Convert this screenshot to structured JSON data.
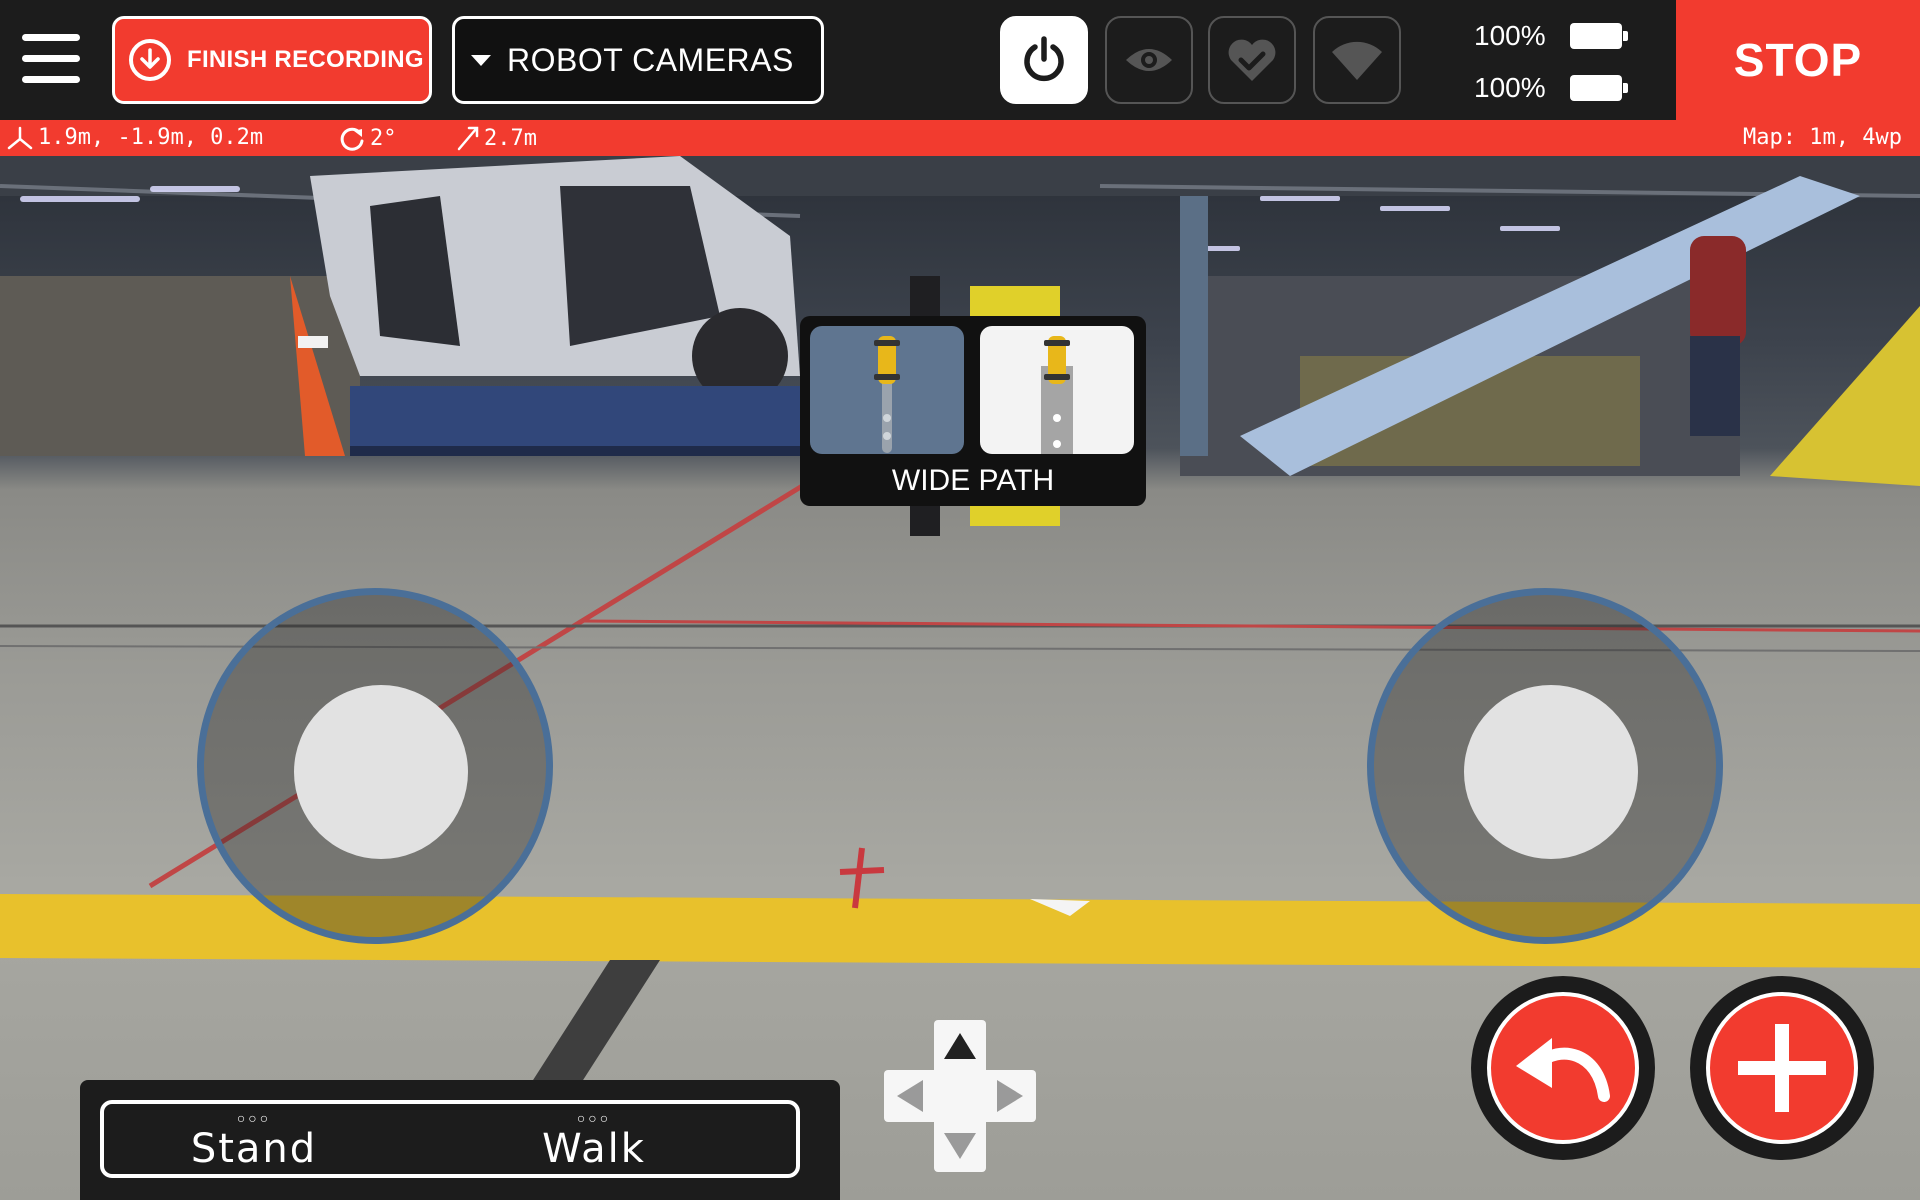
{
  "topbar": {
    "finish_recording_label": "FINISH RECORDING",
    "camera_select_label": "ROBOT CAMERAS",
    "battery_1": "100%",
    "battery_2": "100%",
    "stop_label": "STOP"
  },
  "status": {
    "position": "1.9m, -1.9m, 0.2m",
    "rotation": "2°",
    "distance": "2.7m",
    "map": "Map: 1m, 4wp"
  },
  "path_mode": {
    "label": "WIDE PATH"
  },
  "controls": {
    "stand_label": "Stand",
    "walk_label": "Walk",
    "mode_dots": "○○○"
  },
  "colors": {
    "accent_red": "#f23b2f",
    "bar_dark": "#1c1c1c",
    "joystick_ring": "#4a6f98",
    "floor_yellow": "#e8c12c"
  },
  "icons": {
    "menu": "hamburger-icon",
    "finish": "download-circle-icon",
    "power": "power-icon",
    "eye": "eye-icon",
    "heart": "heart-check-icon",
    "wifi": "wifi-icon",
    "undo": "undo-arrow-icon",
    "add": "plus-icon"
  }
}
